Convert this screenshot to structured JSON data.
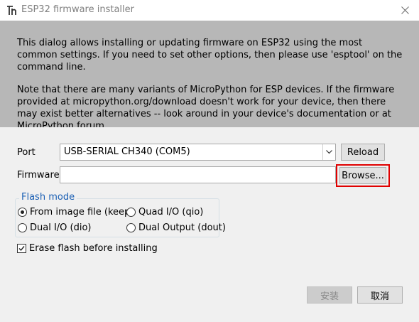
{
  "window": {
    "title": "ESP32 firmware installer",
    "icon": "thonny-icon",
    "close_icon": "close-icon"
  },
  "info": {
    "paragraph1": "This dialog allows installing or updating firmware on ESP32 using the most common settings. If you need to set other options, then please use 'esptool' on the command line.",
    "paragraph2": "Note that there are many variants of MicroPython for ESP devices. If the firmware provided at micropython.org/download doesn't work for your device, then there may exist better alternatives -- look around in your device's documentation or at MicroPython forum."
  },
  "form": {
    "port_label": "Port",
    "port_value": "USB-SERIAL CH340 (COM5)",
    "reload_label": "Reload",
    "firmware_label": "Firmware",
    "firmware_value": "",
    "browse_label": "Browse..."
  },
  "flash_mode": {
    "legend": "Flash mode",
    "options": [
      {
        "label": "From image file (keep)",
        "checked": true
      },
      {
        "label": "Quad I/O (qio)",
        "checked": false
      },
      {
        "label": "Dual I/O (dio)",
        "checked": false
      },
      {
        "label": "Dual Output (dout)",
        "checked": false
      }
    ],
    "selected": "From image file (keep)"
  },
  "erase": {
    "label": "Erase flash before installing",
    "checked": true
  },
  "actions": {
    "install_label": "安装",
    "install_enabled": false,
    "cancel_label": "取消"
  },
  "colors": {
    "info_background": "#b7b7b7",
    "highlight": "#e00000",
    "legend_text": "#1a5fb4"
  }
}
